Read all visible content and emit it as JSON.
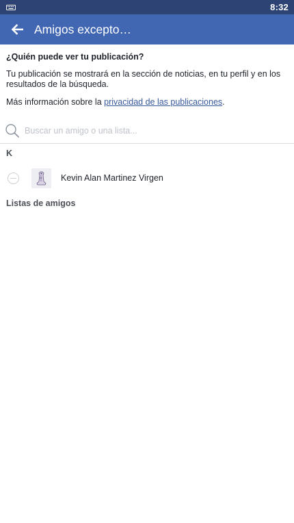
{
  "status_bar": {
    "time": "8:32",
    "left_icon": "keyboard-icon"
  },
  "app_bar": {
    "back_icon": "arrow-left-icon",
    "title": "Amigos excepto…",
    "background": "#4267b2"
  },
  "audience": {
    "question": "¿Quién puede ver tu publicación?",
    "description": "Tu publicación se mostrará en la sección de noticias, en tu perfil y en los resultados de la búsqueda.",
    "more_info_prefix": "Más información sobre la ",
    "more_info_link": "privacidad de las publicaciones",
    "more_info_suffix": ".",
    "link_color": "#365899"
  },
  "search": {
    "icon": "search-icon",
    "placeholder": "Buscar un amigo o una lista...",
    "value": ""
  },
  "friends_section": {
    "header": "K",
    "friends": [
      {
        "name": "Kevin Alan Martinez Virgen",
        "selected": false
      }
    ]
  },
  "lists_section": {
    "header": "Listas de amigos"
  }
}
